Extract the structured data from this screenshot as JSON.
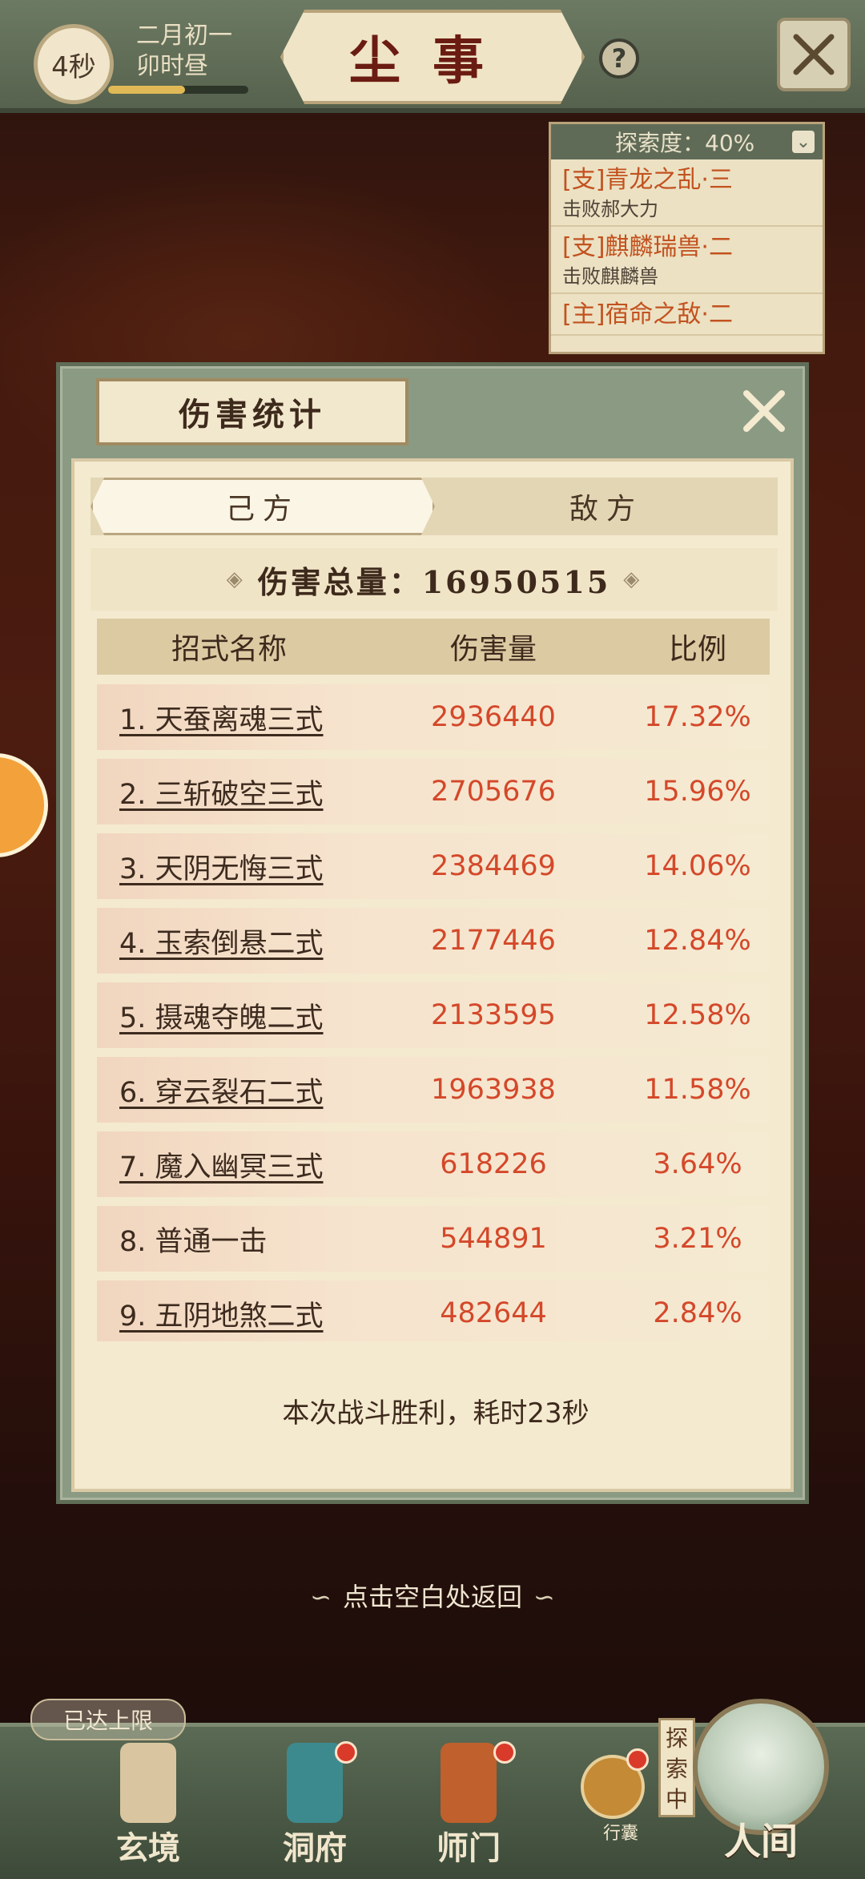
{
  "topbar": {
    "timer": "4秒",
    "date_line1": "二月初一",
    "date_line2": "卯时昼",
    "progress": 0.55,
    "title": "尘事",
    "help": "?"
  },
  "quest_panel": {
    "header": "探索度：40%",
    "items": [
      {
        "title": "[支]青龙之乱·三",
        "sub": "击败郝大力"
      },
      {
        "title": "[支]麒麟瑞兽·二",
        "sub": "击败麒麟兽"
      },
      {
        "title": "[主]宿命之敌·二",
        "sub": ""
      }
    ]
  },
  "modal": {
    "title": "伤害统计",
    "tabs": {
      "own": "己方",
      "enemy": "敌方"
    },
    "total_label": "伤害总量：16950515",
    "columns": {
      "name": "招式名称",
      "damage": "伤害量",
      "ratio": "比例"
    },
    "rows": [
      {
        "name": "1. 天蚕离魂三式",
        "damage": "2936440",
        "ratio": "17.32%",
        "underline": true
      },
      {
        "name": "2. 三斩破空三式",
        "damage": "2705676",
        "ratio": "15.96%",
        "underline": true
      },
      {
        "name": "3. 天阴无悔三式",
        "damage": "2384469",
        "ratio": "14.06%",
        "underline": true
      },
      {
        "name": "4. 玉索倒悬二式",
        "damage": "2177446",
        "ratio": "12.84%",
        "underline": true
      },
      {
        "name": "5. 摄魂夺魄二式",
        "damage": "2133595",
        "ratio": "12.58%",
        "underline": true
      },
      {
        "name": "6. 穿云裂石二式",
        "damage": "1963938",
        "ratio": "11.58%",
        "underline": true
      },
      {
        "name": "7. 魔入幽冥三式",
        "damage": "618226",
        "ratio": "3.64%",
        "underline": true
      },
      {
        "name": "8. 普通一击",
        "damage": "544891",
        "ratio": "3.21%",
        "underline": false
      },
      {
        "name": "9. 五阴地煞二式",
        "damage": "482644",
        "ratio": "2.84%",
        "underline": true
      }
    ],
    "result": "本次战斗胜利，耗时23秒"
  },
  "hint": "点击空白处返回",
  "bottom": {
    "max_badge": "已达上限",
    "nav": [
      "玄境",
      "洞府",
      "师门"
    ],
    "pouch": "行囊",
    "explore_tag": "探索中",
    "world": "人间"
  },
  "colors": {
    "accent_red": "#d4482a",
    "panel_green": "#8b9a83",
    "paper": "#f4ead0"
  }
}
